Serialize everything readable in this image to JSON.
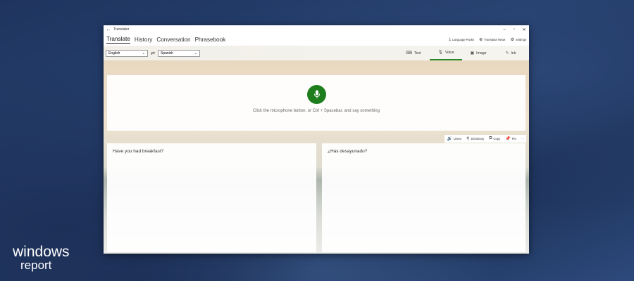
{
  "window": {
    "title": "Translator"
  },
  "nav": {
    "tabs": [
      "Translate",
      "History",
      "Conversation",
      "Phrasebook"
    ],
    "right": [
      {
        "label": "Language Packs",
        "icon": "download-icon"
      },
      {
        "label": "Translator News",
        "icon": "globe-icon"
      },
      {
        "label": "Settings",
        "icon": "gear-icon"
      }
    ]
  },
  "languages": {
    "from": "English",
    "to": "Spanish"
  },
  "modes": [
    {
      "label": "Text",
      "icon": "keyboard-icon"
    },
    {
      "label": "Voice",
      "icon": "microphone-icon",
      "active": true
    },
    {
      "label": "Image",
      "icon": "image-icon"
    },
    {
      "label": "Ink",
      "icon": "pen-icon"
    }
  ],
  "voice": {
    "prompt": "Click the microphone button, or Ctrl + Spacebar, and say something"
  },
  "actions": [
    "Listen",
    "Dictionary",
    "Copy",
    "Pin"
  ],
  "source_text": "Have you had breakfast?",
  "target_text": "¿Has desayunado?",
  "watermark": {
    "line1": "windows",
    "line2": "report"
  },
  "colors": {
    "accent": "#1e7e1e",
    "background": "#22396a"
  }
}
